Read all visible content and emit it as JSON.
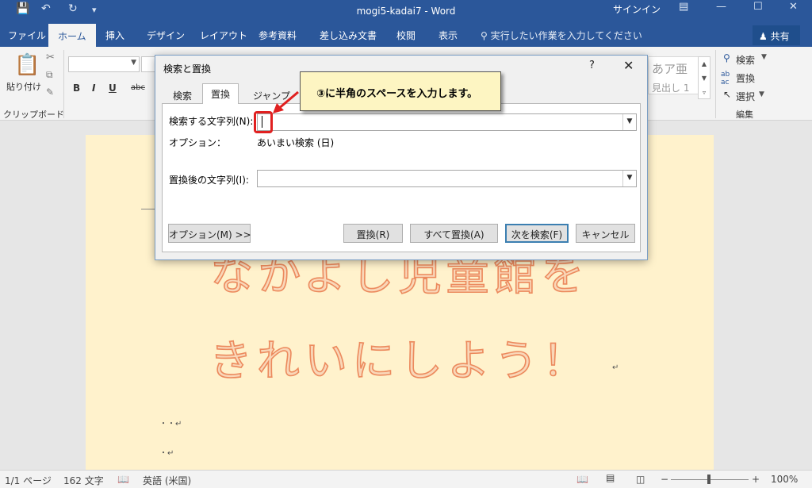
{
  "titlebar": {
    "title": "mogi5-kadai7  -  Word",
    "signin": "サインイン",
    "qa_save_icon": "save-icon",
    "qa_undo_icon": "undo-icon",
    "qa_redo_icon": "redo-icon"
  },
  "tabs": [
    {
      "label": "ファイル"
    },
    {
      "label": "ホーム"
    },
    {
      "label": "挿入"
    },
    {
      "label": "デザイン"
    },
    {
      "label": "レイアウト"
    },
    {
      "label": "参考資料"
    },
    {
      "label": "差し込み文書"
    },
    {
      "label": "校閲"
    },
    {
      "label": "表示"
    }
  ],
  "tellme": "実行したい作業を入力してください",
  "share": "共有",
  "ribbon": {
    "paste": "貼り付け",
    "clipboard_group": "クリップボード",
    "bold": "B",
    "italic": "I",
    "underline": "U",
    "strike": "abc",
    "style_sample": "あア亜",
    "style_name": "見出し 1",
    "find": "検索",
    "replace": "置換",
    "select": "選択",
    "edit_group": "編集"
  },
  "dialog": {
    "title": "検索と置換",
    "help": "?",
    "tabs": [
      "検索",
      "置換",
      "ジャンプ"
    ],
    "find_label": "検索する文字列(N):",
    "options_label": "オプション：",
    "options_value": "あいまい検索 (日)",
    "replace_label": "置換後の文字列(I):",
    "buttons": {
      "more": "オプション(M) >>",
      "replace": "置換(R)",
      "replace_all": "すべて置換(A)",
      "find_next": "次を検索(F)",
      "cancel": "キャンセル"
    }
  },
  "callout": "③に半角のスペースを入力します。",
  "document": {
    "line1": "なかよし児童館を",
    "line2": "きれいにしよう！",
    "para_mark": "↵",
    "dots_line": "・・↵",
    "dot_line": "・↵"
  },
  "statusbar": {
    "page": "1/1 ページ",
    "words": "162 文字",
    "lang": "英語 (米国)",
    "zoom": "100%"
  },
  "colors": {
    "brand": "#2b579a",
    "page_bg": "#fff2cc",
    "title_fill": "#f9d7b8",
    "title_stroke": "#ec8a5d",
    "highlight": "#e02020"
  }
}
